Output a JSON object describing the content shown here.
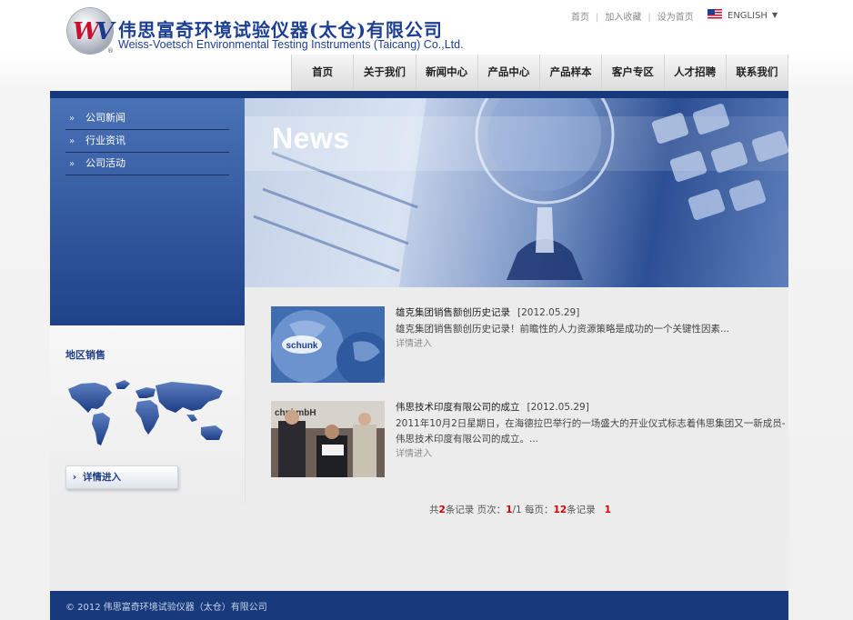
{
  "header": {
    "company_cn": "伟思富奇环境试验仪器(太仓)有限公司",
    "company_en": "Weiss-Voetsch Environmental Testing Instruments (Taicang) Co.,Ltd.",
    "logo_mark": "W",
    "logo_reg": "®",
    "toplinks": [
      "首页",
      "加入收藏",
      "设为首页"
    ],
    "separator": "|",
    "language": "ENGLISH",
    "language_caret": "▼"
  },
  "nav": {
    "items": [
      "首页",
      "关于我们",
      "新闻中心",
      "产品中心",
      "产品样本",
      "客户专区",
      "人才招聘",
      "联系我们"
    ]
  },
  "sidebar": {
    "arrow": "»",
    "items": [
      "公司新闻",
      "行业资讯",
      "公司活动"
    ]
  },
  "region": {
    "title": "地区销售",
    "button": "详情进入",
    "button_icon": "›"
  },
  "banner": {
    "title": "News"
  },
  "news": [
    {
      "title": "雄克集团销售额创历史记录",
      "date": "[2012.05.29]",
      "summary": "雄克集团销售额创历史记录！前瞻性的人力资源策略是成功的一个关键性因素...",
      "more": "详情进入",
      "thumb_text": "schunk"
    },
    {
      "title": "伟思技术印度有限公司的成立",
      "date": "[2012.05.29]",
      "summary": "2011年10月2日星期日，在海德拉巴举行的一场盛大的开业仪式标志着伟思集团又一新成员-伟思技术印度有限公司的成立。...",
      "more": "详情进入",
      "thumb_text": "chni  mbH"
    }
  ],
  "pager": {
    "p1": "共",
    "total": "2",
    "p2": "条记录 页次：",
    "page": "1",
    "p3": "/1 每页：",
    "per_page": "12",
    "p4": "条记录",
    "link": "1"
  },
  "footer": {
    "copyright": "© 2012 伟思富奇环境试验仪器（太仓）有限公司"
  },
  "colors": {
    "brand_blue": "#1c3f94",
    "nav_dark_blue": "#173a7c",
    "pager_red": "#d00000"
  }
}
